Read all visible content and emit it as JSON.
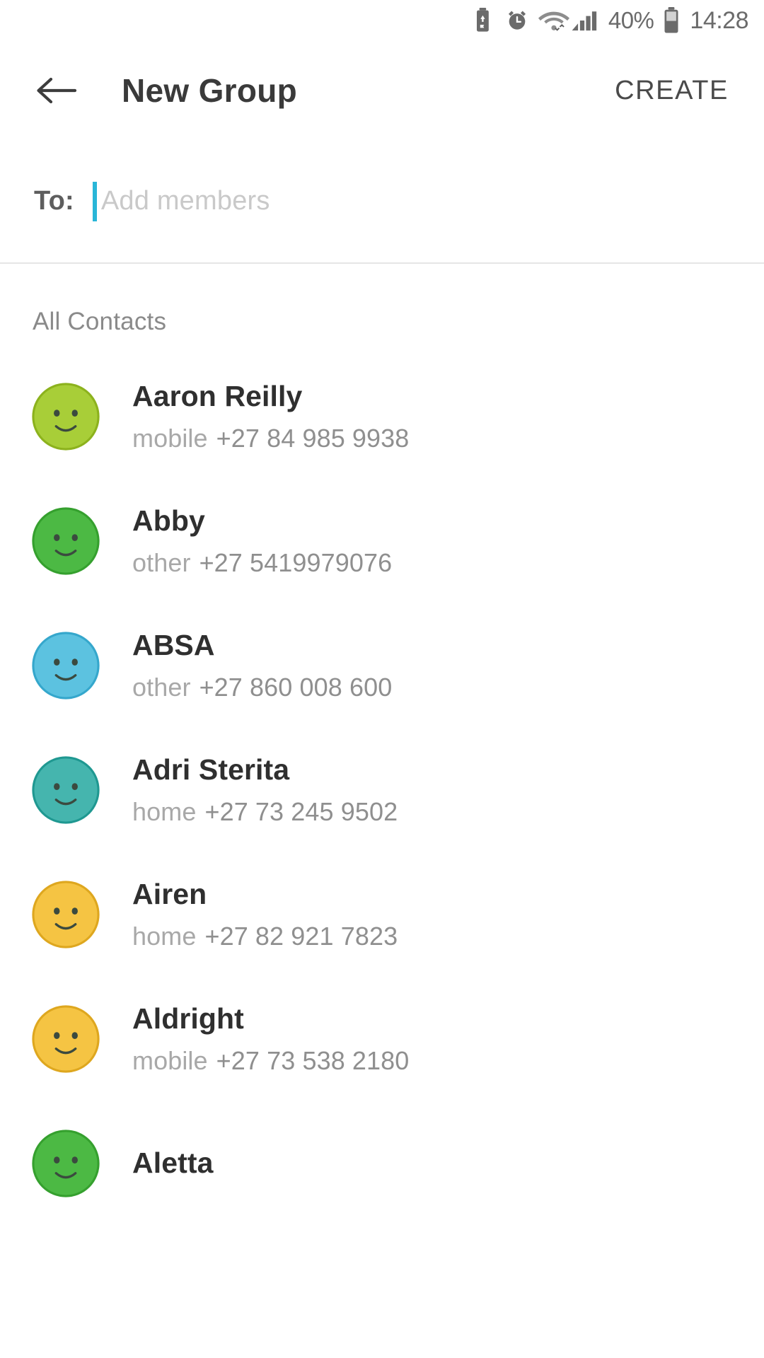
{
  "status_bar": {
    "icons": [
      "battery-saver-icon",
      "alarm-clock-icon",
      "wifi-icon",
      "signal-bars-icon"
    ],
    "battery_percent": "40%",
    "battery_icon": "battery-icon",
    "time": "14:28"
  },
  "app_bar": {
    "back_icon": "back-arrow-icon",
    "title": "New Group",
    "create_label": "CREATE"
  },
  "to_field": {
    "label": "To:",
    "placeholder": "Add members",
    "value": "",
    "caret_color": "#29b6d8"
  },
  "section": {
    "all_contacts_label": "All Contacts"
  },
  "contacts": [
    {
      "name": "Aaron Reilly",
      "type": "mobile",
      "number": "+27 84 985 9938",
      "avatar_color": "#a8ce38",
      "avatar_stroke": "#8cb21d"
    },
    {
      "name": "Abby",
      "type": "other",
      "number": "+27 5419979076",
      "avatar_color": "#4cb944",
      "avatar_stroke": "#35a02e"
    },
    {
      "name": "ABSA",
      "type": "other",
      "number": "+27 860 008 600",
      "avatar_color": "#5cc2e0",
      "avatar_stroke": "#35a7cc"
    },
    {
      "name": "Adri Sterita",
      "type": "home",
      "number": "+27 73 245 9502",
      "avatar_color": "#45b5ae",
      "avatar_stroke": "#1f9891"
    },
    {
      "name": "Airen",
      "type": "home",
      "number": "+27 82 921 7823",
      "avatar_color": "#f5c443",
      "avatar_stroke": "#dea71f"
    },
    {
      "name": "Aldright",
      "type": "mobile",
      "number": "+27 73 538 2180",
      "avatar_color": "#f5c443",
      "avatar_stroke": "#dea71f"
    },
    {
      "name": "Aletta",
      "type": "",
      "number": "",
      "avatar_color": "#4cb944",
      "avatar_stroke": "#35a02e"
    }
  ]
}
